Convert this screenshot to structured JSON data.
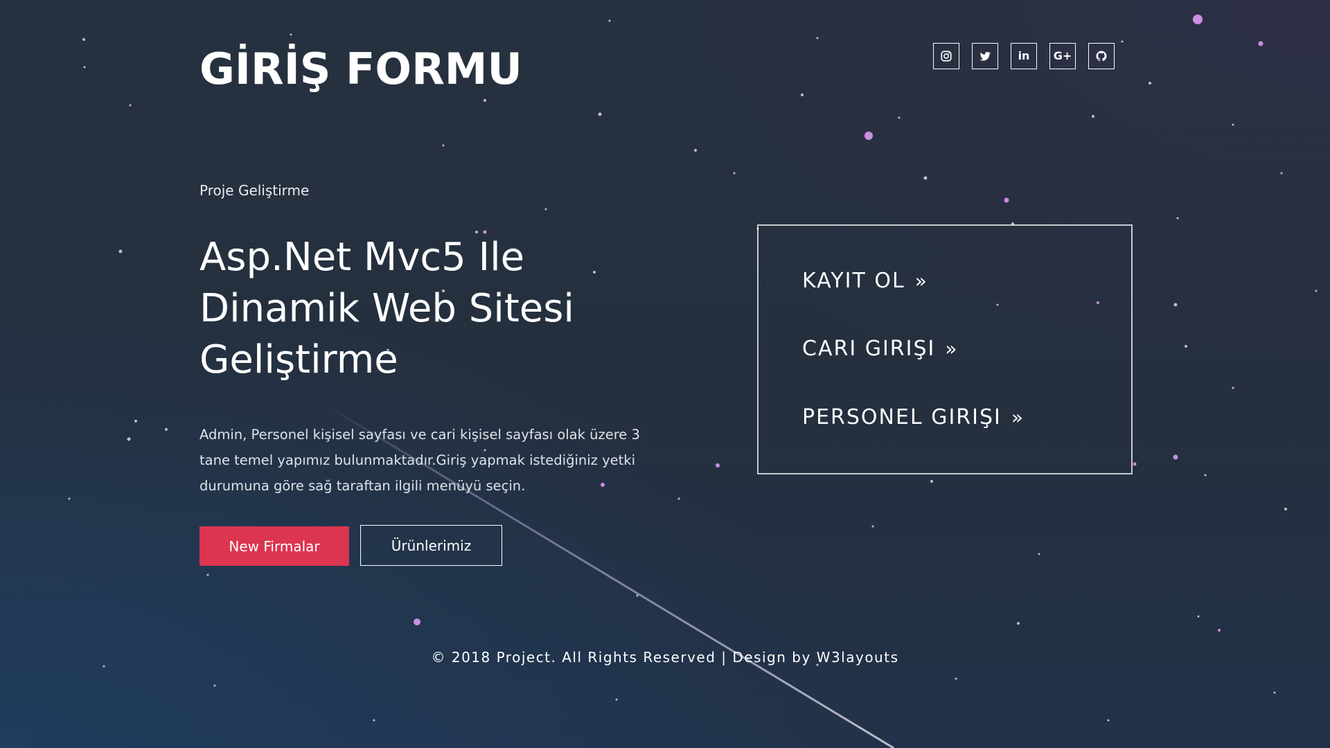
{
  "header": {
    "title": "GİRİŞ FORMU",
    "social": [
      {
        "icon": "instagram-icon"
      },
      {
        "icon": "twitter-icon"
      },
      {
        "icon": "linkedin-icon",
        "text": "in"
      },
      {
        "icon": "google-plus-icon",
        "text": "G+"
      },
      {
        "icon": "github-icon"
      }
    ]
  },
  "hero": {
    "eyebrow": "Proje Geliştirme",
    "heading_lines": [
      "Asp.Net Mvc5 Ile",
      "Dinamik Web Sitesi",
      "Geliştirme"
    ],
    "description": "Admin, Personel kişisel sayfası ve cari kişisel sayfası olak üzere 3 tane temel yapımız bulunmaktadır.Giriş yapmak istediğiniz yetki durumuna göre sağ taraftan ilgili menüyü seçin.",
    "primary_button": "New Firmalar",
    "secondary_button": "Ürünlerimiz"
  },
  "login_panel": {
    "items": [
      {
        "label": "KAYIT OL",
        "arrow": "»"
      },
      {
        "label": "CARI GIRIŞI",
        "arrow": "»"
      },
      {
        "label": "PERSONEL GIRIŞI",
        "arrow": "»"
      }
    ]
  },
  "footer": {
    "text": "© 2018 Project. All Rights Reserved | Design by W3layouts"
  },
  "colors": {
    "background": "#25303f",
    "accent": "#dc3550",
    "text": "#ffffff"
  }
}
